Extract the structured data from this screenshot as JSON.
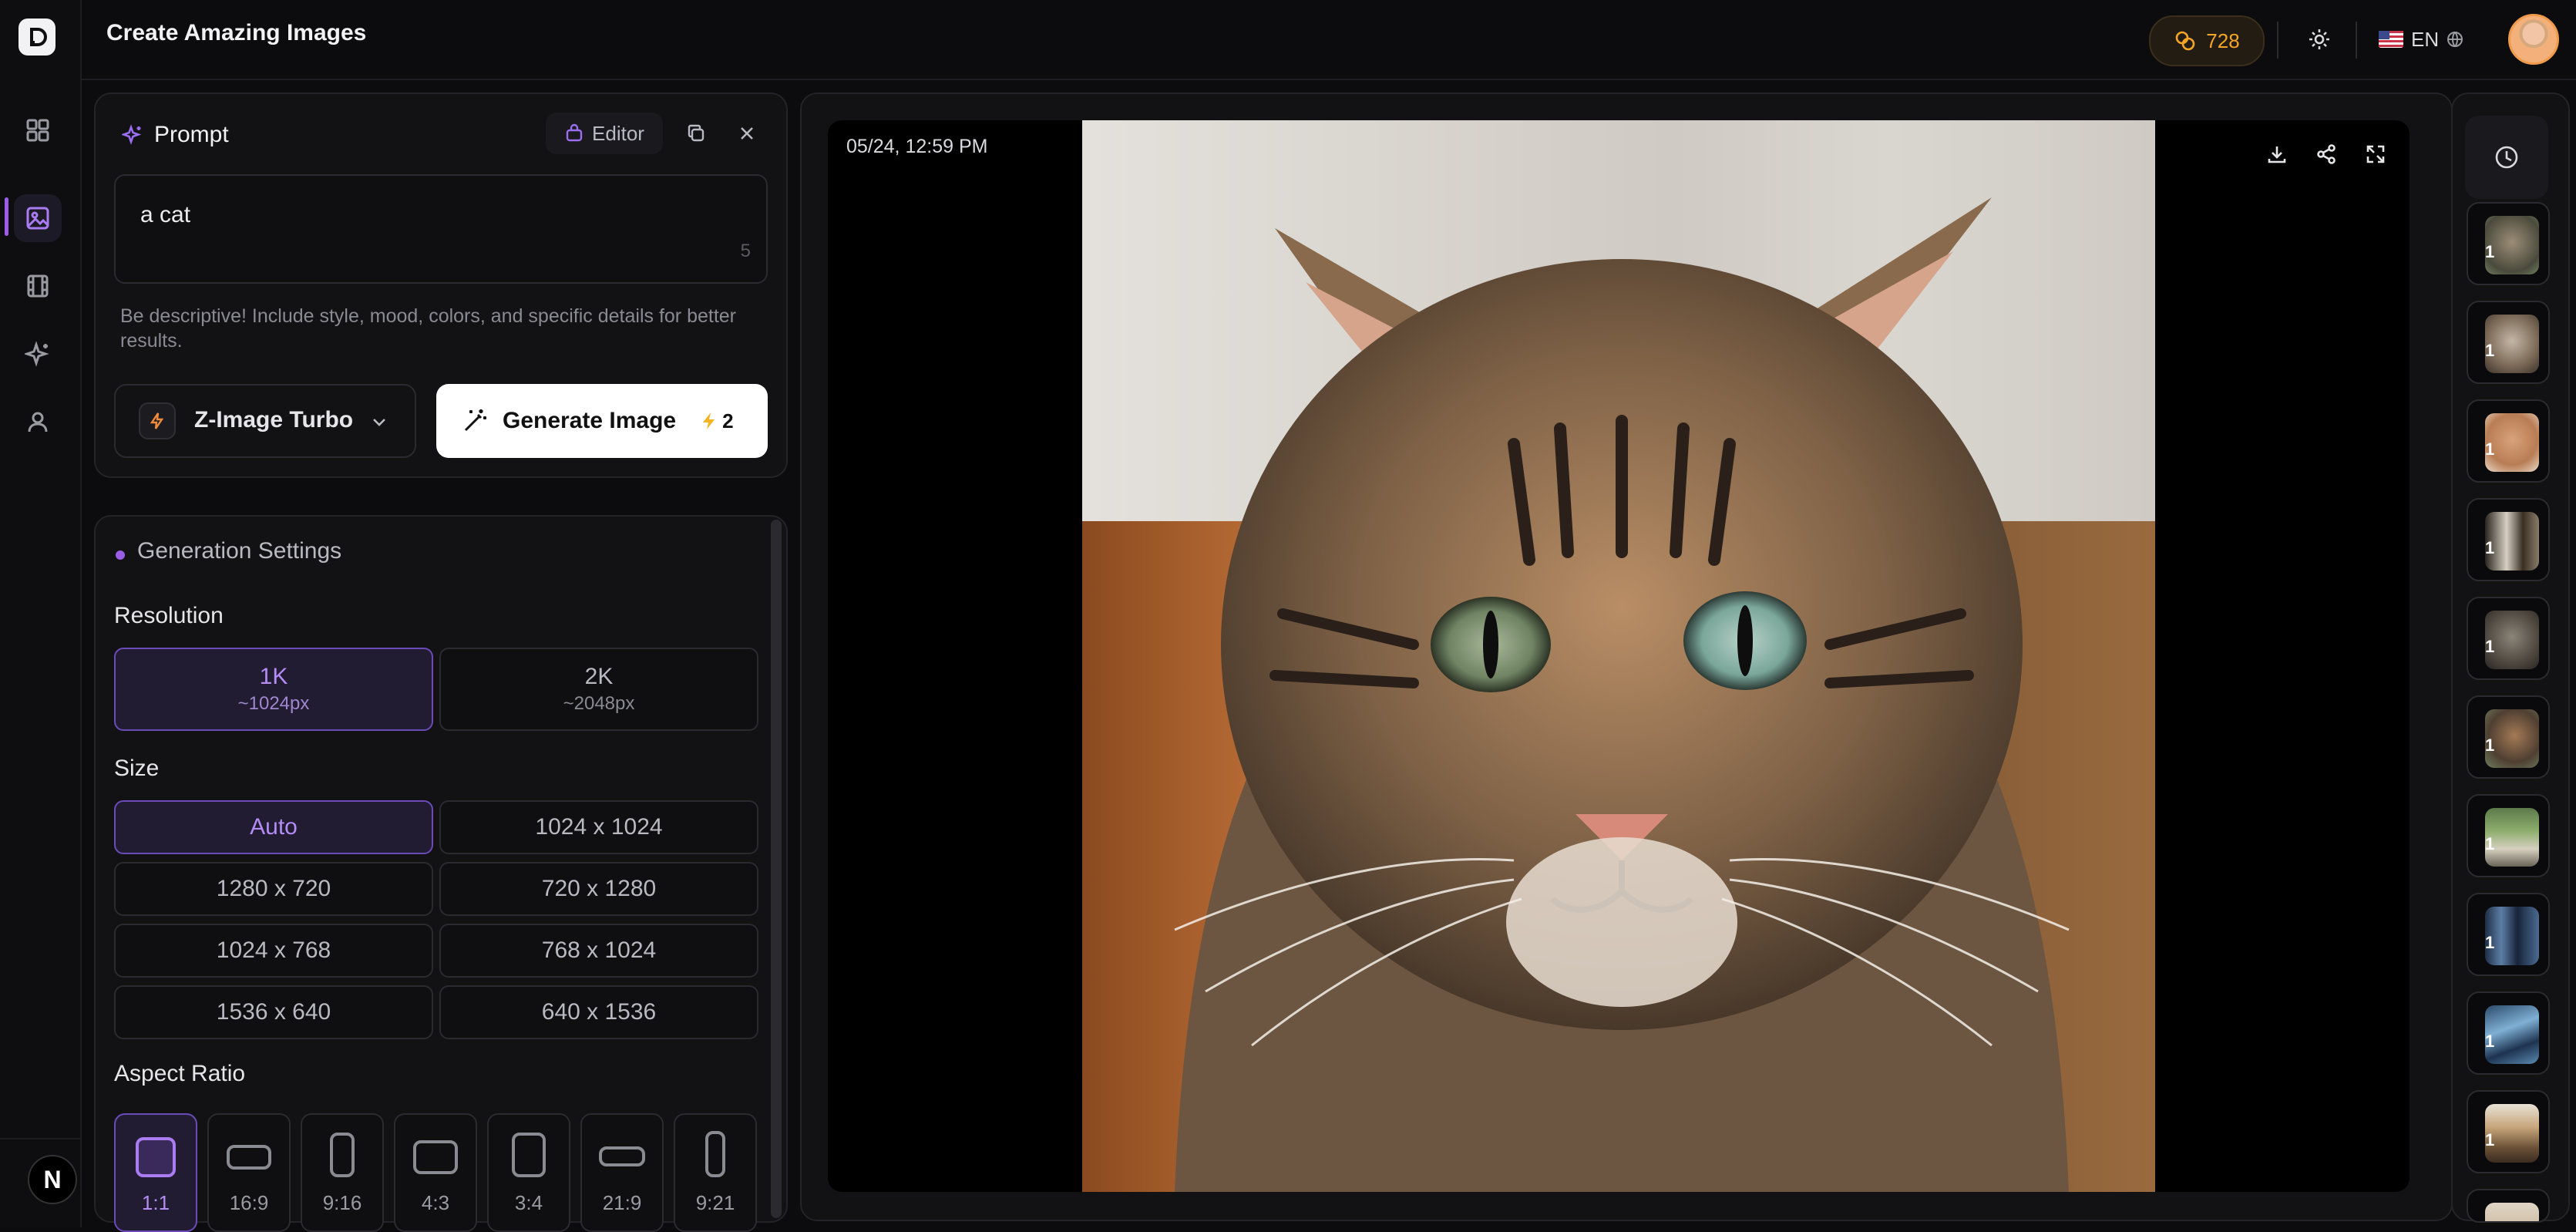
{
  "app": {
    "title": "Create Amazing Images",
    "credits": "728",
    "language": "EN"
  },
  "prompt": {
    "title": "Prompt",
    "editor_label": "Editor",
    "value": "a cat",
    "char_count": "5",
    "hint": "Be descriptive! Include style, mood, colors, and specific details for better results."
  },
  "model": {
    "name": "Z-Image Turbo"
  },
  "generate": {
    "label": "Generate Image",
    "cost": "2"
  },
  "settings": {
    "title": "Generation Settings",
    "resolution": {
      "label": "Resolution",
      "options": [
        {
          "label": "1K",
          "sub": "~1024px",
          "selected": true
        },
        {
          "label": "2K",
          "sub": "~2048px",
          "selected": false
        }
      ]
    },
    "size": {
      "label": "Size",
      "options": [
        "Auto",
        "1024 x 1024",
        "1280 x 720",
        "720 x 1280",
        "1024 x 768",
        "768 x 1024",
        "1536 x 640",
        "640 x 1536"
      ],
      "selected": "Auto"
    },
    "aspect": {
      "label": "Aspect Ratio",
      "options": [
        "1:1",
        "16:9",
        "9:16",
        "4:3",
        "3:4",
        "21:9",
        "9:21"
      ],
      "selected": "1:1"
    }
  },
  "viewer": {
    "timestamp": "05/24, 12:59 PM"
  },
  "history": {
    "counts": [
      "1",
      "1",
      "1",
      "1",
      "1",
      "1",
      "1",
      "1",
      "1",
      "1"
    ]
  },
  "user": {
    "initial": "N"
  },
  "colors": {
    "accent": "#9b5de5",
    "credits": "#f5a524",
    "background": "#0c0c0e"
  }
}
